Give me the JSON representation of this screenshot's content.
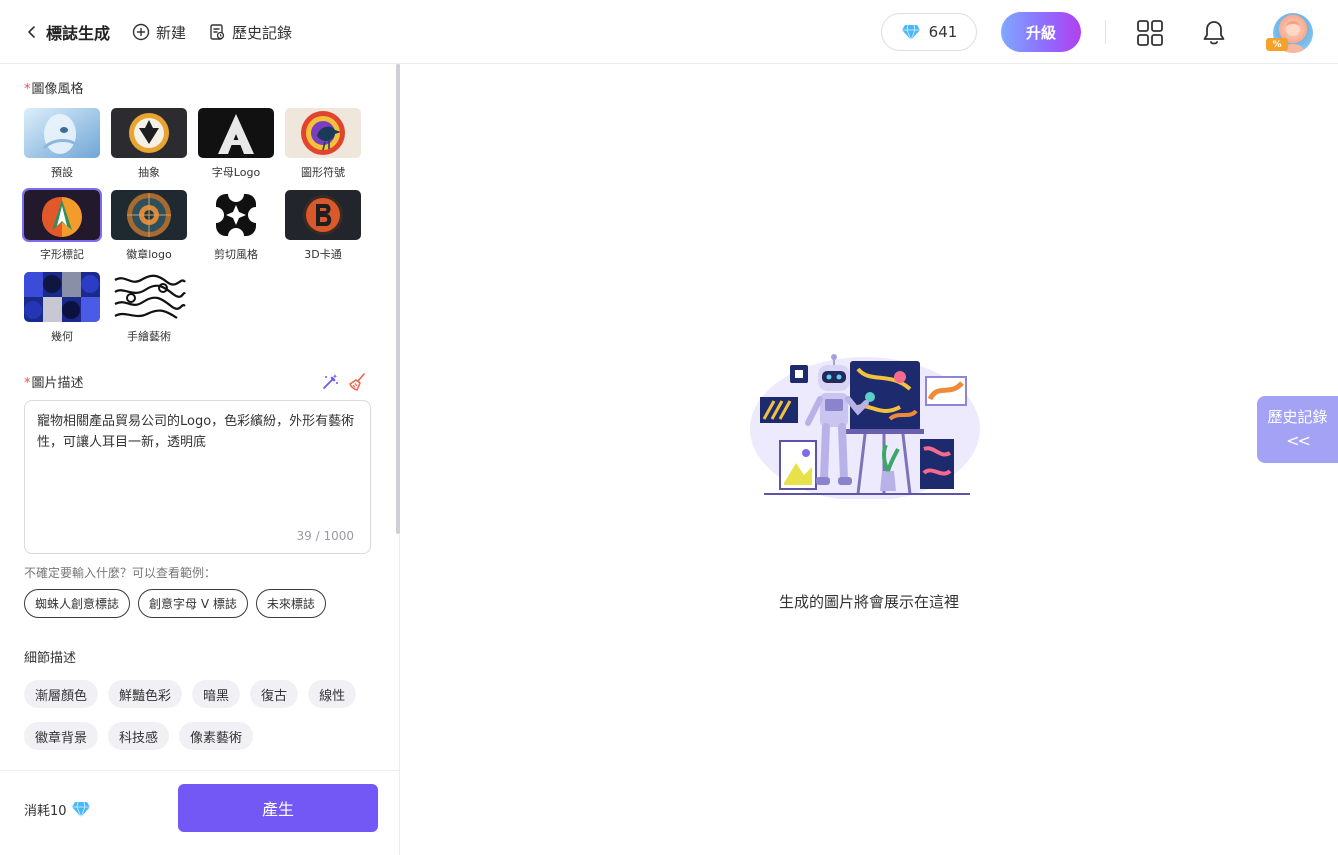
{
  "header": {
    "title": "標誌生成",
    "new_label": "新建",
    "history_label": "歷史記錄",
    "credits": "641",
    "upgrade_label": "升級",
    "avatar_badge": "%"
  },
  "image_style": {
    "label": "圖像風格",
    "required_mark": "*",
    "selected_index": 4,
    "items": [
      {
        "name": "預設"
      },
      {
        "name": "抽象"
      },
      {
        "name": "字母Logo"
      },
      {
        "name": "圖形符號"
      },
      {
        "name": "字形標記"
      },
      {
        "name": "徽章logo"
      },
      {
        "name": "剪切風格"
      },
      {
        "name": "3D卡通"
      },
      {
        "name": "幾何"
      },
      {
        "name": "手繪藝術"
      }
    ]
  },
  "description": {
    "label": "圖片描述",
    "required_mark": "*",
    "value": "寵物相關產品貿易公司的Logo，色彩繽紛，外形有藝術性，可讓人耳目一新，透明底",
    "count": "39 / 1000"
  },
  "examples": {
    "hint": "不確定要輸入什麼？可以查看範例：",
    "items": [
      "蜘蛛人創意標誌",
      "創意字母 V 標誌",
      "未來標誌"
    ]
  },
  "details": {
    "label": "細節描述",
    "rows": [
      [
        "漸層顏色",
        "鮮豔色彩",
        "暗黑",
        "復古",
        "線性"
      ],
      [
        "徽章背景",
        "科技感",
        "像素藝術"
      ]
    ]
  },
  "footer": {
    "cost_label": "消耗10",
    "generate_label": "產生"
  },
  "canvas": {
    "placeholder": "生成的圖片將會展示在這裡"
  },
  "history_tab": {
    "label": "歷史記錄",
    "chevron": "<<"
  },
  "colors": {
    "accent": "#7358f5",
    "history_tab": "#a3a2f5",
    "required": "#f04a4a"
  }
}
